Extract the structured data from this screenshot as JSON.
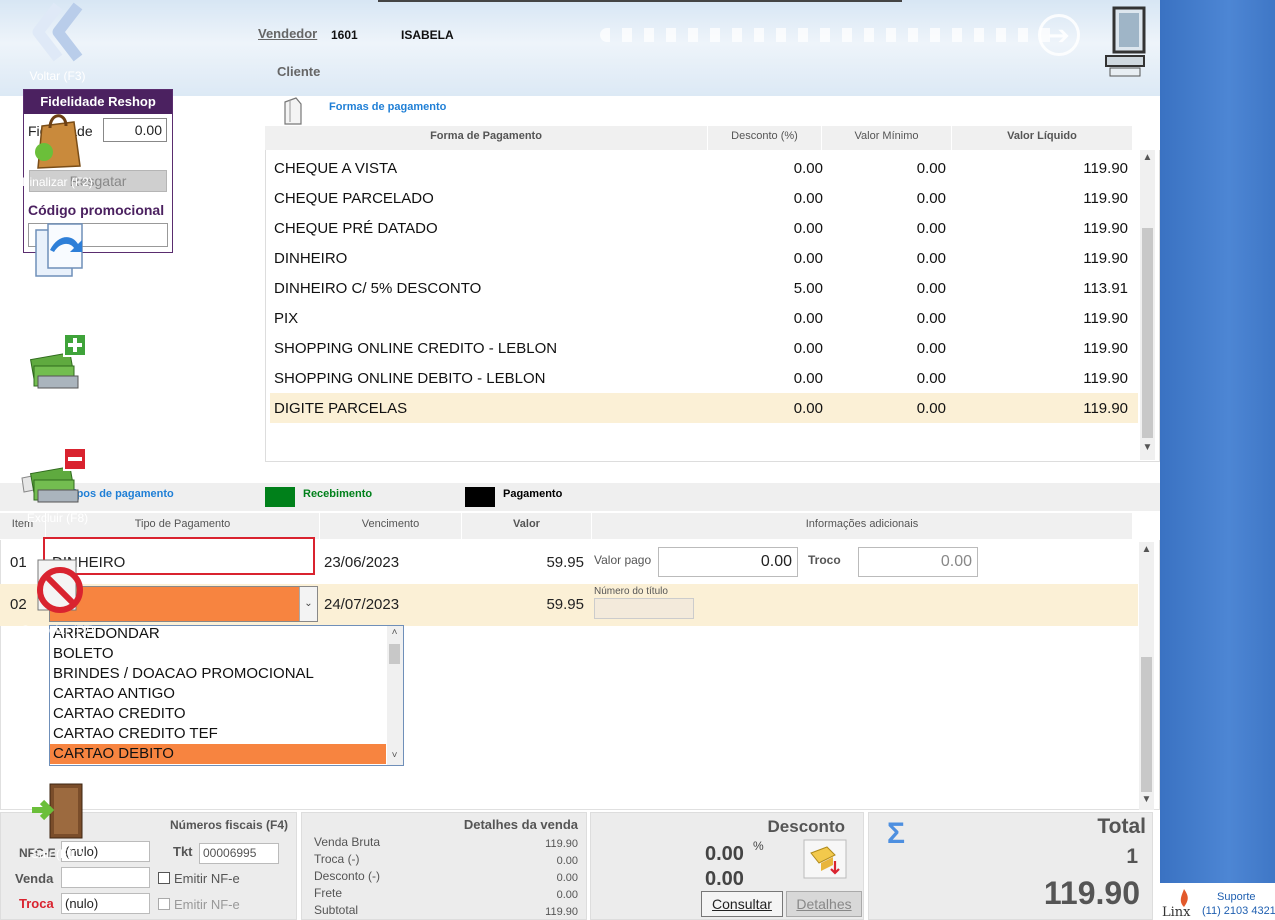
{
  "header": {
    "vendedor_label": "Vendedor",
    "vendedor_code": "1601",
    "vendedor_name": "ISABELA",
    "cliente_label": "Cliente"
  },
  "fidelidade": {
    "title": "Fidelidade Reshop",
    "label": "Fidelidade",
    "value": "0.00",
    "resgatar": "Resgatar",
    "promo_label": "Código promocional",
    "promo_value": ""
  },
  "formas": {
    "title": "Formas de pagamento",
    "columns": [
      "Forma de Pagamento",
      "Desconto (%)",
      "Valor Mínimo",
      "Valor Líquido"
    ],
    "rows": [
      [
        "CHEQUE A VISTA",
        "0.00",
        "0.00",
        "119.90"
      ],
      [
        "CHEQUE PARCELADO",
        "0.00",
        "0.00",
        "119.90"
      ],
      [
        "CHEQUE PRÉ DATADO",
        "0.00",
        "0.00",
        "119.90"
      ],
      [
        "DINHEIRO",
        "0.00",
        "0.00",
        "119.90"
      ],
      [
        "DINHEIRO C/ 5% DESCONTO",
        "5.00",
        "0.00",
        "113.91"
      ],
      [
        "PIX",
        "0.00",
        "0.00",
        "119.90"
      ],
      [
        "SHOPPING ONLINE CREDITO - LEBLON",
        "0.00",
        "0.00",
        "119.90"
      ],
      [
        "SHOPPING ONLINE DEBITO - LEBLON",
        "0.00",
        "0.00",
        "119.90"
      ],
      [
        "DIGITE PARCELAS",
        "0.00",
        "0.00",
        "119.90"
      ]
    ],
    "selected_index": 8
  },
  "tipos": {
    "title": "Tipos de pagamento",
    "legend_recebimento": "Recebimento",
    "legend_pagamento": "Pagamento",
    "columns": [
      "Item",
      "Tipo de Pagamento",
      "Vencimento",
      "Valor",
      "Informações adicionais"
    ],
    "row1": {
      "item": "01",
      "tipo": "DINHEIRO",
      "vencimento": "23/06/2023",
      "valor": "59.95",
      "valor_pago_label": "Valor pago",
      "valor_pago": "0.00",
      "troco_label": "Troco",
      "troco": "0.00"
    },
    "row2": {
      "item": "02",
      "tipo": "",
      "vencimento": "24/07/2023",
      "valor": "59.95",
      "numero_label": "Número do título",
      "numero": ""
    },
    "dropdown_options": [
      "ARREDONDAR",
      "BOLETO",
      "BRINDES / DOACAO PROMOCIONAL",
      "CARTAO ANTIGO",
      "CARTAO CREDITO",
      "CARTAO CREDITO TEF",
      "CARTAO DEBITO"
    ],
    "dropdown_highlight": 6
  },
  "fiscais": {
    "title": "Números fiscais (F4)",
    "nfce_label": "NFC-E",
    "nfce_value": "(nulo)",
    "tkt_label": "Tkt",
    "tkt_value": "00006995",
    "venda_label": "Venda",
    "venda_value": "",
    "emitir1": "Emitir NF-e",
    "troca_label": "Troca",
    "troca_value": "(nulo)",
    "emitir2": "Emitir NF-e"
  },
  "detalhes": {
    "title": "Detalhes da venda",
    "rows": [
      [
        "Venda Bruta",
        "119.90"
      ],
      [
        "Troca (-)",
        "0.00"
      ],
      [
        "Desconto (-)",
        "0.00"
      ],
      [
        "Frete",
        "0.00"
      ],
      [
        "Subtotal",
        "119.90"
      ]
    ]
  },
  "desconto": {
    "title": "Desconto",
    "percent": "0.00",
    "percent_sign": "%",
    "value": "0.00",
    "consultar": "Consultar",
    "detalhes": "Detalhes"
  },
  "total": {
    "title": "Total",
    "qty": "1",
    "value": "119.90",
    "sigma": "Σ"
  },
  "sidebar": {
    "buttons": [
      "Voltar (F3)",
      "Finalizar (F2)",
      "Liberar/Copiar (F6",
      "Incluir (F9)",
      "Excluir (F8)",
      "Cancelar (F7)",
      "Sair (F11)"
    ],
    "suporte": "Suporte",
    "phone": "(11) 2103 4321",
    "brand": "Linx"
  },
  "colors": {
    "accent_purple": "#4b2160",
    "selection_orange": "#f78440",
    "row_highlight": "#fbf0d6",
    "recebimento_green": "#00801a",
    "sidebar_blue": "#4d86d4",
    "link_blue": "#1f7fd6"
  }
}
